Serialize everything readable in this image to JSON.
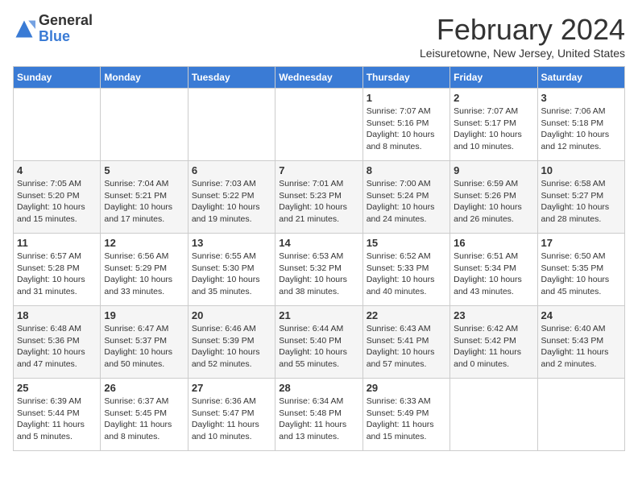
{
  "header": {
    "logo_general": "General",
    "logo_blue": "Blue",
    "month_title": "February 2024",
    "subtitle": "Leisuretowne, New Jersey, United States"
  },
  "days_of_week": [
    "Sunday",
    "Monday",
    "Tuesday",
    "Wednesday",
    "Thursday",
    "Friday",
    "Saturday"
  ],
  "weeks": [
    [
      {
        "day": "",
        "info": ""
      },
      {
        "day": "",
        "info": ""
      },
      {
        "day": "",
        "info": ""
      },
      {
        "day": "",
        "info": ""
      },
      {
        "day": "1",
        "info": "Sunrise: 7:07 AM\nSunset: 5:16 PM\nDaylight: 10 hours\nand 8 minutes."
      },
      {
        "day": "2",
        "info": "Sunrise: 7:07 AM\nSunset: 5:17 PM\nDaylight: 10 hours\nand 10 minutes."
      },
      {
        "day": "3",
        "info": "Sunrise: 7:06 AM\nSunset: 5:18 PM\nDaylight: 10 hours\nand 12 minutes."
      }
    ],
    [
      {
        "day": "4",
        "info": "Sunrise: 7:05 AM\nSunset: 5:20 PM\nDaylight: 10 hours\nand 15 minutes."
      },
      {
        "day": "5",
        "info": "Sunrise: 7:04 AM\nSunset: 5:21 PM\nDaylight: 10 hours\nand 17 minutes."
      },
      {
        "day": "6",
        "info": "Sunrise: 7:03 AM\nSunset: 5:22 PM\nDaylight: 10 hours\nand 19 minutes."
      },
      {
        "day": "7",
        "info": "Sunrise: 7:01 AM\nSunset: 5:23 PM\nDaylight: 10 hours\nand 21 minutes."
      },
      {
        "day": "8",
        "info": "Sunrise: 7:00 AM\nSunset: 5:24 PM\nDaylight: 10 hours\nand 24 minutes."
      },
      {
        "day": "9",
        "info": "Sunrise: 6:59 AM\nSunset: 5:26 PM\nDaylight: 10 hours\nand 26 minutes."
      },
      {
        "day": "10",
        "info": "Sunrise: 6:58 AM\nSunset: 5:27 PM\nDaylight: 10 hours\nand 28 minutes."
      }
    ],
    [
      {
        "day": "11",
        "info": "Sunrise: 6:57 AM\nSunset: 5:28 PM\nDaylight: 10 hours\nand 31 minutes."
      },
      {
        "day": "12",
        "info": "Sunrise: 6:56 AM\nSunset: 5:29 PM\nDaylight: 10 hours\nand 33 minutes."
      },
      {
        "day": "13",
        "info": "Sunrise: 6:55 AM\nSunset: 5:30 PM\nDaylight: 10 hours\nand 35 minutes."
      },
      {
        "day": "14",
        "info": "Sunrise: 6:53 AM\nSunset: 5:32 PM\nDaylight: 10 hours\nand 38 minutes."
      },
      {
        "day": "15",
        "info": "Sunrise: 6:52 AM\nSunset: 5:33 PM\nDaylight: 10 hours\nand 40 minutes."
      },
      {
        "day": "16",
        "info": "Sunrise: 6:51 AM\nSunset: 5:34 PM\nDaylight: 10 hours\nand 43 minutes."
      },
      {
        "day": "17",
        "info": "Sunrise: 6:50 AM\nSunset: 5:35 PM\nDaylight: 10 hours\nand 45 minutes."
      }
    ],
    [
      {
        "day": "18",
        "info": "Sunrise: 6:48 AM\nSunset: 5:36 PM\nDaylight: 10 hours\nand 47 minutes."
      },
      {
        "day": "19",
        "info": "Sunrise: 6:47 AM\nSunset: 5:37 PM\nDaylight: 10 hours\nand 50 minutes."
      },
      {
        "day": "20",
        "info": "Sunrise: 6:46 AM\nSunset: 5:39 PM\nDaylight: 10 hours\nand 52 minutes."
      },
      {
        "day": "21",
        "info": "Sunrise: 6:44 AM\nSunset: 5:40 PM\nDaylight: 10 hours\nand 55 minutes."
      },
      {
        "day": "22",
        "info": "Sunrise: 6:43 AM\nSunset: 5:41 PM\nDaylight: 10 hours\nand 57 minutes."
      },
      {
        "day": "23",
        "info": "Sunrise: 6:42 AM\nSunset: 5:42 PM\nDaylight: 11 hours\nand 0 minutes."
      },
      {
        "day": "24",
        "info": "Sunrise: 6:40 AM\nSunset: 5:43 PM\nDaylight: 11 hours\nand 2 minutes."
      }
    ],
    [
      {
        "day": "25",
        "info": "Sunrise: 6:39 AM\nSunset: 5:44 PM\nDaylight: 11 hours\nand 5 minutes."
      },
      {
        "day": "26",
        "info": "Sunrise: 6:37 AM\nSunset: 5:45 PM\nDaylight: 11 hours\nand 8 minutes."
      },
      {
        "day": "27",
        "info": "Sunrise: 6:36 AM\nSunset: 5:47 PM\nDaylight: 11 hours\nand 10 minutes."
      },
      {
        "day": "28",
        "info": "Sunrise: 6:34 AM\nSunset: 5:48 PM\nDaylight: 11 hours\nand 13 minutes."
      },
      {
        "day": "29",
        "info": "Sunrise: 6:33 AM\nSunset: 5:49 PM\nDaylight: 11 hours\nand 15 minutes."
      },
      {
        "day": "",
        "info": ""
      },
      {
        "day": "",
        "info": ""
      }
    ]
  ]
}
